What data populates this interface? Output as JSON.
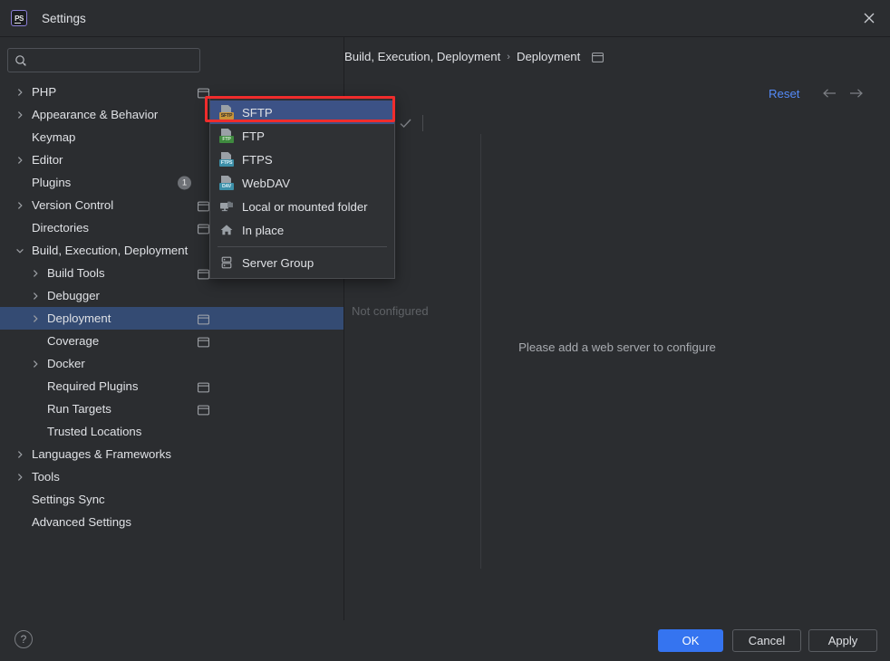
{
  "window": {
    "app_icon": "phpstorm-icon",
    "title": "Settings",
    "close_icon": "close-icon"
  },
  "search": {
    "icon": "search-icon",
    "value": "",
    "placeholder": ""
  },
  "sidebar": {
    "items": [
      {
        "label": "PHP",
        "indent": 0,
        "arrow": "chevron-right",
        "window_icon": true,
        "badge": null,
        "selected": false
      },
      {
        "label": "Appearance & Behavior",
        "indent": 0,
        "arrow": "chevron-right",
        "window_icon": false,
        "badge": null,
        "selected": false
      },
      {
        "label": "Keymap",
        "indent": 0,
        "arrow": "none",
        "window_icon": false,
        "badge": null,
        "selected": false
      },
      {
        "label": "Editor",
        "indent": 0,
        "arrow": "chevron-right",
        "window_icon": false,
        "badge": null,
        "selected": false
      },
      {
        "label": "Plugins",
        "indent": 0,
        "arrow": "none",
        "window_icon": false,
        "badge": "1",
        "selected": false
      },
      {
        "label": "Version Control",
        "indent": 0,
        "arrow": "chevron-right",
        "window_icon": true,
        "badge": null,
        "selected": false
      },
      {
        "label": "Directories",
        "indent": 0,
        "arrow": "none",
        "window_icon": true,
        "badge": null,
        "selected": false
      },
      {
        "label": "Build, Execution, Deployment",
        "indent": 0,
        "arrow": "chevron-down",
        "window_icon": false,
        "badge": null,
        "selected": false
      },
      {
        "label": "Build Tools",
        "indent": 1,
        "arrow": "chevron-right",
        "window_icon": true,
        "badge": null,
        "selected": false
      },
      {
        "label": "Debugger",
        "indent": 1,
        "arrow": "chevron-right",
        "window_icon": false,
        "badge": null,
        "selected": false
      },
      {
        "label": "Deployment",
        "indent": 1,
        "arrow": "chevron-right",
        "window_icon": true,
        "badge": null,
        "selected": true
      },
      {
        "label": "Coverage",
        "indent": 1,
        "arrow": "none",
        "window_icon": true,
        "badge": null,
        "selected": false
      },
      {
        "label": "Docker",
        "indent": 1,
        "arrow": "chevron-right",
        "window_icon": false,
        "badge": null,
        "selected": false
      },
      {
        "label": "Required Plugins",
        "indent": 1,
        "arrow": "none",
        "window_icon": true,
        "badge": null,
        "selected": false
      },
      {
        "label": "Run Targets",
        "indent": 1,
        "arrow": "none",
        "window_icon": true,
        "badge": null,
        "selected": false
      },
      {
        "label": "Trusted Locations",
        "indent": 1,
        "arrow": "none",
        "window_icon": false,
        "badge": null,
        "selected": false
      },
      {
        "label": "Languages & Frameworks",
        "indent": 0,
        "arrow": "chevron-right",
        "window_icon": false,
        "badge": null,
        "selected": false
      },
      {
        "label": "Tools",
        "indent": 0,
        "arrow": "chevron-right",
        "window_icon": false,
        "badge": null,
        "selected": false
      },
      {
        "label": "Settings Sync",
        "indent": 0,
        "arrow": "none",
        "window_icon": false,
        "badge": null,
        "selected": false
      },
      {
        "label": "Advanced Settings",
        "indent": 0,
        "arrow": "none",
        "window_icon": false,
        "badge": null,
        "selected": false
      }
    ]
  },
  "breadcrumb": {
    "root": "Build, Execution, Deployment",
    "separator": "›",
    "leaf": "Deployment",
    "window_icon": "window-icon"
  },
  "actions": {
    "reset_label": "Reset",
    "back_icon": "arrow-left-icon",
    "forward_icon": "arrow-right-icon"
  },
  "toolbar": {
    "add_icon": "plus-icon",
    "remove_icon": "minus-icon",
    "default_icon": "check-icon"
  },
  "server_panel": {
    "not_configured": "Not configured",
    "empty_message": "Please add a web server to configure"
  },
  "popup_menu": {
    "items": [
      {
        "label": "SFTP",
        "icon": "sftp-icon",
        "tag": "SFTP",
        "tag_bg": "#C7943A",
        "tag_fg": "#2B2D30",
        "highlighted": true,
        "separator_after": false
      },
      {
        "label": "FTP",
        "icon": "ftp-icon",
        "tag": "FTP",
        "tag_bg": "#3F8A3F",
        "tag_fg": "#D8F0D8",
        "highlighted": false,
        "separator_after": false
      },
      {
        "label": "FTPS",
        "icon": "ftps-icon",
        "tag": "FTPS",
        "tag_bg": "#3C8FA8",
        "tag_fg": "#DFF3FA",
        "highlighted": false,
        "separator_after": false
      },
      {
        "label": "WebDAV",
        "icon": "webdav-icon",
        "tag": "DAV",
        "tag_bg": "#3C8FA8",
        "tag_fg": "#DFF3FA",
        "highlighted": false,
        "separator_after": false
      },
      {
        "label": "Local or mounted folder",
        "icon": "local-folder-icon",
        "tag": "",
        "tag_bg": "",
        "tag_fg": "",
        "highlighted": false,
        "separator_after": false
      },
      {
        "label": "In place",
        "icon": "home-icon",
        "tag": "",
        "tag_bg": "",
        "tag_fg": "",
        "highlighted": false,
        "separator_after": true
      },
      {
        "label": "Server Group",
        "icon": "server-group-icon",
        "tag": "",
        "tag_bg": "",
        "tag_fg": "",
        "highlighted": false,
        "separator_after": false
      }
    ],
    "highlight_color": "#3C5286",
    "focus_outline_color": "#F02C2C"
  },
  "footer": {
    "help_label": "?",
    "ok_label": "OK",
    "cancel_label": "Cancel",
    "apply_label": "Apply",
    "accent_color": "#3574F0"
  }
}
